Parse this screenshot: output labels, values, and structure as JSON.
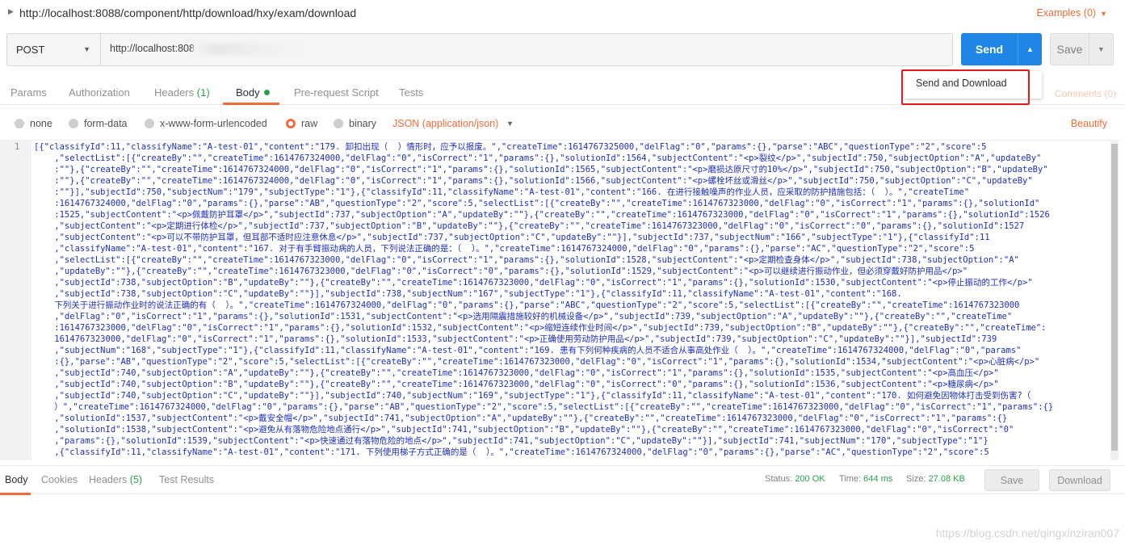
{
  "header": {
    "title": "http://localhost:8088/component/http/download/hxy/exam/download",
    "examples": "Examples (0)"
  },
  "request": {
    "method": "POST",
    "url_visible": "http://localhost:808"
  },
  "actions": {
    "send": "Send",
    "save": "Save",
    "dropdown_item": "Send and Download"
  },
  "tabs": {
    "params": "Params",
    "authorization": "Authorization",
    "headers": "Headers",
    "headers_count": "(1)",
    "body": "Body",
    "prerequest": "Pre-request Script",
    "tests": "Tests",
    "comments": "Comments (0)"
  },
  "body_types": {
    "none": "none",
    "form_data": "form-data",
    "urlencoded": "x-www-form-urlencoded",
    "raw": "raw",
    "binary": "binary",
    "raw_format": "JSON (application/json)",
    "beautify": "Beautify",
    "selected": "raw"
  },
  "editor": {
    "line_number": "1",
    "lines": [
      "[{\"classifyId\":11,\"classifyName\":\"A-test-01\",\"content\":\"179. 卸扣出现（  ）情形时，应予以报废。\",\"createTime\":1614767325000,\"delFlag\":\"0\",\"params\":{},\"parse\":\"ABC\",\"questionType\":\"2\",\"score\":5",
      "    ,\"selectList\":[{\"createBy\":\"\",\"createTime\":1614767324000,\"delFlag\":\"0\",\"isCorrect\":\"1\",\"params\":{},\"solutionId\":1564,\"subjectContent\":\"<p>裂纹</p>\",\"subjectId\":750,\"subjectOption\":\"A\",\"updateBy\"",
      "    :\"\"},{\"createBy\":\"\",\"createTime\":1614767324000,\"delFlag\":\"0\",\"isCorrect\":\"1\",\"params\":{},\"solutionId\":1565,\"subjectContent\":\"<p>磨损达原尺寸的10%</p>\",\"subjectId\":750,\"subjectOption\":\"B\",\"updateBy\"",
      "    :\"\"},{\"createBy\":\"\",\"createTime\":1614767324000,\"delFlag\":\"0\",\"isCorrect\":\"1\",\"params\":{},\"solutionId\":1566,\"subjectContent\":\"<p>螺栓坏丝或滑丝</p>\",\"subjectId\":750,\"subjectOption\":\"C\",\"updateBy\"",
      "    :\"\"}],\"subjectId\":750,\"subjectNum\":\"179\",\"subjectType\":\"1\"},{\"classifyId\":11,\"classifyName\":\"A-test-01\",\"content\":\"166. 在进行接触噪声的作业人员，应采取的防护措施包括：（  ）。\",\"createTime\"",
      "    :1614767324000,\"delFlag\":\"0\",\"params\":{},\"parse\":\"AB\",\"questionType\":\"2\",\"score\":5,\"selectList\":[{\"createBy\":\"\",\"createTime\":1614767323000,\"delFlag\":\"0\",\"isCorrect\":\"1\",\"params\":{},\"solutionId\"",
      "    :1525,\"subjectContent\":\"<p>佩戴防护耳罩</p>\",\"subjectId\":737,\"subjectOption\":\"A\",\"updateBy\":\"\"},{\"createBy\":\"\",\"createTime\":1614767323000,\"delFlag\":\"0\",\"isCorrect\":\"1\",\"params\":{},\"solutionId\":1526",
      "    ,\"subjectContent\":\"<p>定期进行体检</p>\",\"subjectId\":737,\"subjectOption\":\"B\",\"updateBy\":\"\"},{\"createBy\":\"\",\"createTime\":1614767323000,\"delFlag\":\"0\",\"isCorrect\":\"0\",\"params\":{},\"solutionId\":1527",
      "    ,\"subjectContent\":\"<p>可以不带防护耳罩，但耳部不适时应注意休息</p>\",\"subjectId\":737,\"subjectOption\":\"C\",\"updateBy\":\"\"}],\"subjectId\":737,\"subjectNum\":\"166\",\"subjectType\":\"1\"},{\"classifyId\":11",
      "    ,\"classifyName\":\"A-test-01\",\"content\":\"167. 对于有手臂振动病的人员，下列说法正确的是：（  ）。\",\"createTime\":1614767324000,\"delFlag\":\"0\",\"params\":{},\"parse\":\"AC\",\"questionType\":\"2\",\"score\":5",
      "    ,\"selectList\":[{\"createBy\":\"\",\"createTime\":1614767323000,\"delFlag\":\"0\",\"isCorrect\":\"1\",\"params\":{},\"solutionId\":1528,\"subjectContent\":\"<p>定期检查身体</p>\",\"subjectId\":738,\"subjectOption\":\"A\"",
      "    ,\"updateBy\":\"\"},{\"createBy\":\"\",\"createTime\":1614767323000,\"delFlag\":\"0\",\"isCorrect\":\"0\",\"params\":{},\"solutionId\":1529,\"subjectContent\":\"<p>可以继续进行振动作业，但必须穿戴好防护用品</p>\"",
      "    ,\"subjectId\":738,\"subjectOption\":\"B\",\"updateBy\":\"\"},{\"createBy\":\"\",\"createTime\":1614767323000,\"delFlag\":\"0\",\"isCorrect\":\"1\",\"params\":{},\"solutionId\":1530,\"subjectContent\":\"<p>停止振动的工作</p>\"",
      "    ,\"subjectId\":738,\"subjectOption\":\"C\",\"updateBy\":\"\"}],\"subjectId\":738,\"subjectNum\":\"167\",\"subjectType\":\"1\"},{\"classifyId\":11,\"classifyName\":\"A-test-01\",\"content\":\"168.",
      "    下列关于进行振动作业时的说法正确的有（  ）。\",\"createTime\":1614767324000,\"delFlag\":\"0\",\"params\":{},\"parse\":\"ABC\",\"questionType\":\"2\",\"score\":5,\"selectList\":[{\"createBy\":\"\",\"createTime\":1614767323000",
      "    ,\"delFlag\":\"0\",\"isCorrect\":\"1\",\"params\":{},\"solutionId\":1531,\"subjectContent\":\"<p>选用隔震措施较好的机械设备</p>\",\"subjectId\":739,\"subjectOption\":\"A\",\"updateBy\":\"\"},{\"createBy\":\"\",\"createTime\"",
      "    :1614767323000,\"delFlag\":\"0\",\"isCorrect\":\"1\",\"params\":{},\"solutionId\":1532,\"subjectContent\":\"<p>缩短连续作业时间</p>\",\"subjectId\":739,\"subjectOption\":\"B\",\"updateBy\":\"\"},{\"createBy\":\"\",\"createTime\":",
      "    1614767323000,\"delFlag\":\"0\",\"isCorrect\":\"1\",\"params\":{},\"solutionId\":1533,\"subjectContent\":\"<p>正确使用劳动防护用品</p>\",\"subjectId\":739,\"subjectOption\":\"C\",\"updateBy\":\"\"}],\"subjectId\":739",
      "    ,\"subjectNum\":\"168\",\"subjectType\":\"1\"},{\"classifyId\":11,\"classifyName\":\"A-test-01\",\"content\":\"169. 患有下列何种疾病的人员不适合从事高处作业（  ）。\",\"createTime\":1614767324000,\"delFlag\":\"0\",\"params\"",
      "    :{},\"parse\":\"AB\",\"questionType\":\"2\",\"score\":5,\"selectList\":[{\"createBy\":\"\",\"createTime\":1614767323000,\"delFlag\":\"0\",\"isCorrect\":\"1\",\"params\":{},\"solutionId\":1534,\"subjectContent\":\"<p>心脏病</p>\"",
      "    ,\"subjectId\":740,\"subjectOption\":\"A\",\"updateBy\":\"\"},{\"createBy\":\"\",\"createTime\":1614767323000,\"delFlag\":\"0\",\"isCorrect\":\"1\",\"params\":{},\"solutionId\":1535,\"subjectContent\":\"<p>高血压</p>\"",
      "    ,\"subjectId\":740,\"subjectOption\":\"B\",\"updateBy\":\"\"},{\"createBy\":\"\",\"createTime\":1614767323000,\"delFlag\":\"0\",\"isCorrect\":\"0\",\"params\":{},\"solutionId\":1536,\"subjectContent\":\"<p>糖尿病</p>\"",
      "    ,\"subjectId\":740,\"subjectOption\":\"C\",\"updateBy\":\"\"}],\"subjectId\":740,\"subjectNum\":\"169\",\"subjectType\":\"1\"},{\"classifyId\":11,\"classifyName\":\"A-test-01\",\"content\":\"170. 如何避免因物体打击受到伤害?（",
      "    ）\",\"createTime\":1614767324000,\"delFlag\":\"0\",\"params\":{},\"parse\":\"AB\",\"questionType\":\"2\",\"score\":5,\"selectList\":[{\"createBy\":\"\",\"createTime\":1614767323000,\"delFlag\":\"0\",\"isCorrect\":\"1\",\"params\":{}",
      "    ,\"solutionId\":1537,\"subjectContent\":\"<p>戴安全帽</p>\",\"subjectId\":741,\"subjectOption\":\"A\",\"updateBy\":\"\"},{\"createBy\":\"\",\"createTime\":1614767323000,\"delFlag\":\"0\",\"isCorrect\":\"1\",\"params\":{}",
      "    ,\"solutionId\":1538,\"subjectContent\":\"<p>避免从有落物危险地点通行</p>\",\"subjectId\":741,\"subjectOption\":\"B\",\"updateBy\":\"\"},{\"createBy\":\"\",\"createTime\":1614767323000,\"delFlag\":\"0\",\"isCorrect\":\"0\"",
      "    ,\"params\":{},\"solutionId\":1539,\"subjectContent\":\"<p>快速通过有落物危险的地点</p>\",\"subjectId\":741,\"subjectOption\":\"C\",\"updateBy\":\"\"}],\"subjectId\":741,\"subjectNum\":\"170\",\"subjectType\":\"1\"}",
      "    ,{\"classifyId\":11,\"classifyName\":\"A-test-01\",\"content\":\"171. 下列使用梯子方式正确的是（  ）。\",\"createTime\":1614767324000,\"delFlag\":\"0\",\"params\":{},\"parse\":\"AC\",\"questionType\":\"2\",\"score\":5"
    ]
  },
  "response": {
    "tabs": {
      "body": "Body",
      "cookies": "Cookies",
      "headers": "Headers",
      "headers_count": "(5)",
      "test_results": "Test Results"
    },
    "status_label": "Status:",
    "status_value": "200 OK",
    "time_label": "Time:",
    "time_value": "644 ms",
    "size_label": "Size:",
    "size_value": "27.08 KB",
    "save": "Save",
    "download": "Download"
  },
  "watermark": "https://blog.csdn.net/qingxinziran007",
  "colors": {
    "accent": "#f26b3a",
    "primary": "#1f86e5",
    "success": "#2aa147",
    "highlight_box": "#e11b1b"
  }
}
